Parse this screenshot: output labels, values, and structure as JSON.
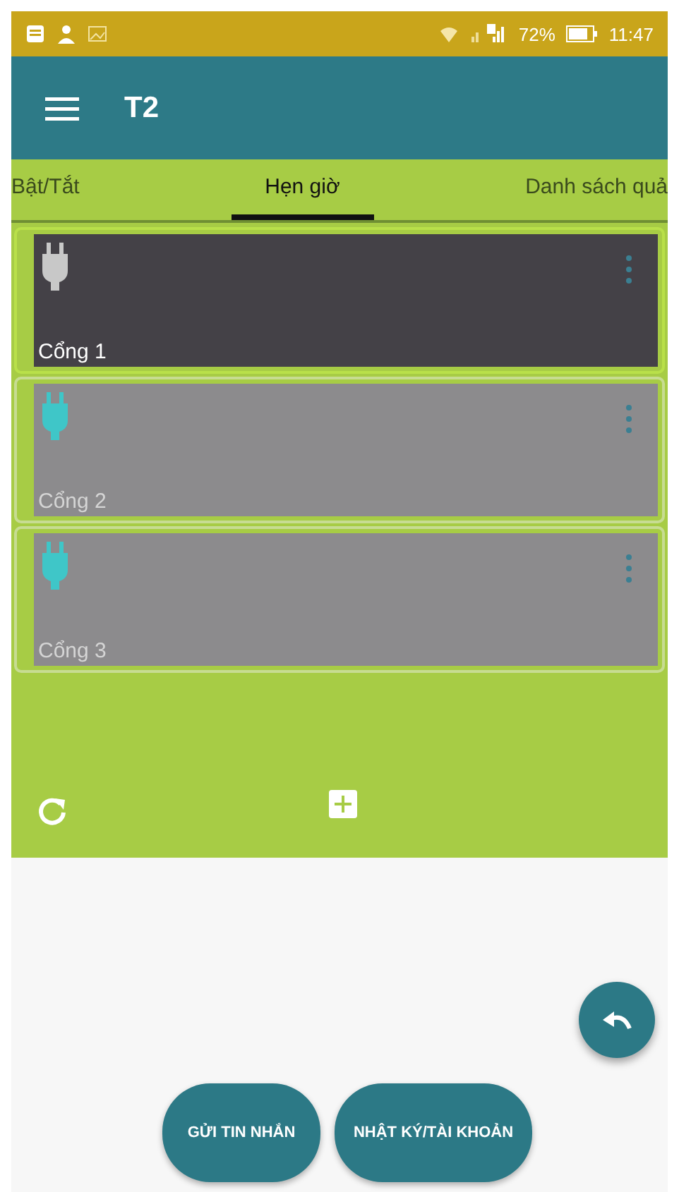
{
  "status_bar": {
    "battery": "72%",
    "time": "11:47"
  },
  "app_bar": {
    "title": "T2"
  },
  "tabs": [
    {
      "label": "Bật/Tắt",
      "selected": false
    },
    {
      "label": "Hẹn giờ",
      "selected": true
    },
    {
      "label": "Danh sách quả",
      "selected": false
    }
  ],
  "ports": [
    {
      "name": "Cổng 1",
      "selected": true
    },
    {
      "name": "Cổng 2",
      "selected": false
    },
    {
      "name": "Cổng 3",
      "selected": false
    }
  ],
  "buttons": [
    {
      "label": "GỬI TIN NHẮN"
    },
    {
      "label": "NHẬT KÝ/TÀI KHOẢN"
    }
  ]
}
